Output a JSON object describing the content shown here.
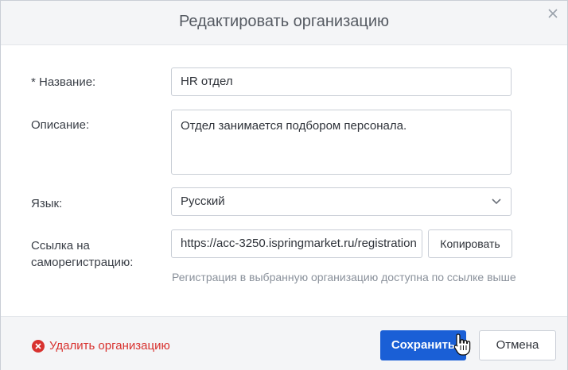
{
  "dialog": {
    "title": "Редактировать организацию",
    "close_icon": "close-icon"
  },
  "form": {
    "name": {
      "label": "* Название:",
      "value": "HR отдел"
    },
    "description": {
      "label": "Описание:",
      "value": "Отдел занимается подбором персонала."
    },
    "language": {
      "label": "Язык:",
      "value": "Русский"
    },
    "self_registration": {
      "label_line1": "Ссылка на",
      "label_line2": "саморегистрацию:",
      "value": "https://acc-3250.ispringmarket.ru/registration",
      "copy_label": "Копировать",
      "hint": "Регистрация в выбранную организацию доступна по ссылке выше"
    }
  },
  "footer": {
    "delete_label": "Удалить организацию",
    "save_label": "Сохранить",
    "cancel_label": "Отмена"
  },
  "colors": {
    "primary": "#1a5fd6",
    "danger": "#d8322f",
    "header_bg": "#f4f5f7"
  }
}
